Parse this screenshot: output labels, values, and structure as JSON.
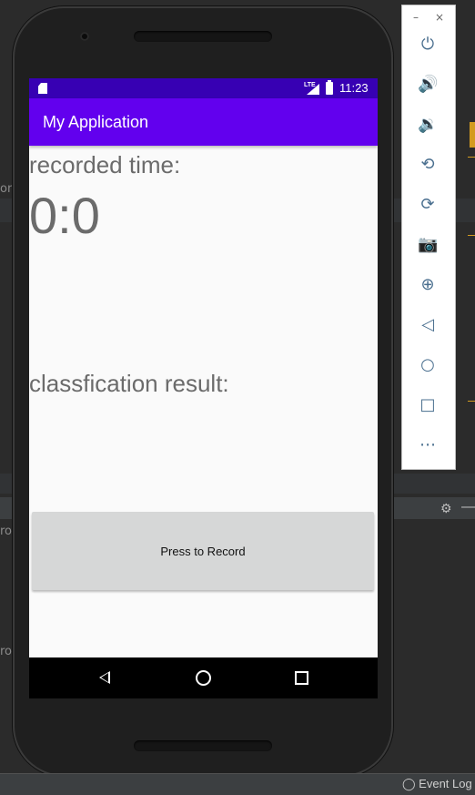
{
  "status_bar": {
    "time": "11:23",
    "network": "LTE"
  },
  "app_bar": {
    "title": "My Application"
  },
  "content": {
    "recorded_time_label": "recorded time:",
    "recorded_time_value": "0:0",
    "result_label": "classfication result:",
    "record_button": "Press to Record"
  },
  "emulator_toolbar": {
    "minimize": "–",
    "close": "×",
    "icons": [
      "power-icon",
      "volume-up-icon",
      "volume-down-icon",
      "rotate-left-icon",
      "rotate-right-icon",
      "camera-icon",
      "zoom-icon",
      "back-icon",
      "home-icon",
      "overview-icon",
      "more-icon"
    ]
  },
  "ide": {
    "event_log": "Event Log"
  },
  "colors": {
    "status_bar": "#3700b3",
    "app_bar": "#6200ee",
    "button": "#d6d7d7",
    "screen_bg": "#fafafa"
  }
}
